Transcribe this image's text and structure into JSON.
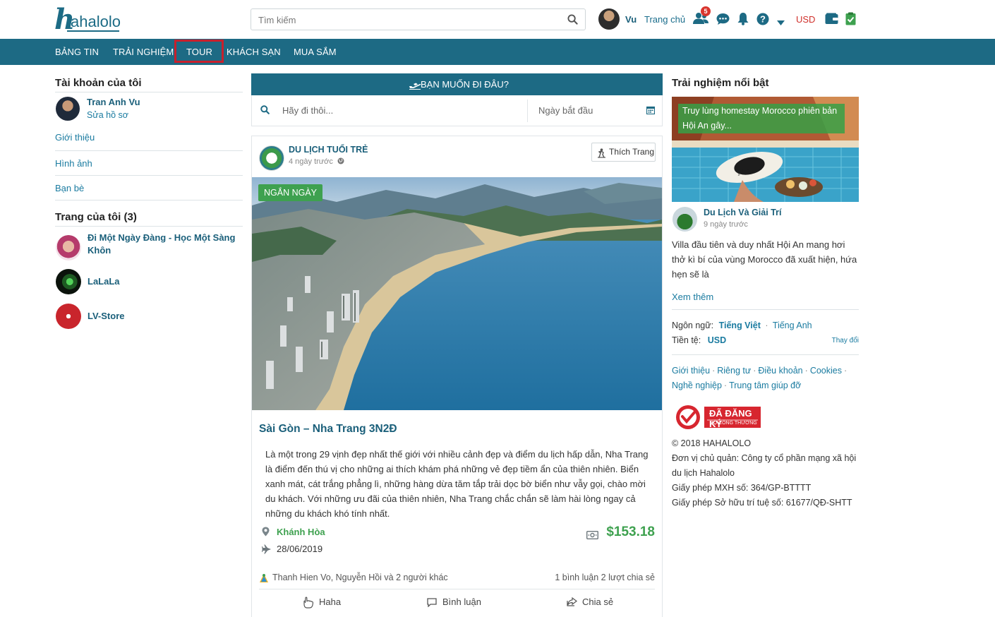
{
  "header": {
    "logo_h": "h",
    "logo_rest": "ahalolo",
    "search_placeholder": "Tìm kiếm",
    "user_name": "Vu",
    "home_label": "Trang chủ",
    "friend_badge": "5",
    "currency": "USD"
  },
  "nav": {
    "items": [
      "BẢNG TIN",
      "TRẢI NGHIỆM",
      "TOUR",
      "KHÁCH SẠN",
      "MUA SẮM"
    ],
    "active": "TOUR"
  },
  "left": {
    "account_title": "Tài khoản của tôi",
    "profile_name": "Tran Anh Vu",
    "profile_edit": "Sửa hồ sơ",
    "links": [
      "Giới thiệu",
      "Hình ảnh",
      "Bạn bè"
    ],
    "pages_title": "Trang của tôi (3)",
    "pages": [
      {
        "name_line1": "Đi Một Ngày Đàng - Học Một Sàng",
        "name_line2": "Khôn"
      },
      {
        "name_line1": "LaLaLa",
        "name_line2": ""
      },
      {
        "name_line1": "LV-Store",
        "name_line2": ""
      }
    ]
  },
  "center": {
    "dest_header": "BẠN MUỐN ĐI ĐÂU?",
    "dest_placeholder": "Hãy đi thôi...",
    "date_placeholder": "Ngày bắt đầu",
    "post": {
      "author": "DU LỊCH TUỔI TRẺ",
      "time": "4 ngày trước",
      "like_label": "Thích Trang",
      "tag": "NGẮN NGÀY",
      "title": "Sài Gòn – Nha Trang 3N2Đ",
      "description": "Là một trong 29 vịnh đẹp nhất thế giới với nhiều cảnh đẹp và điểm du lịch hấp dẫn, Nha Trang là điểm đến thú vị cho những ai thích khám phá những vẻ đẹp tiềm ẩn của thiên nhiên. Biển xanh mát, cát trắng phẳng lì, những hàng dừa tăm tắp trải dọc bờ biển như vẫy gọi, chào mời du khách. Với những ưu đãi của thiên nhiên, Nha Trang chắc chắn sẽ làm hài lòng ngay cả những du khách khó tính nhất.",
      "location": "Khánh Hòa",
      "date": "28/06/2019",
      "price": "$153.18",
      "reactions": "Thanh Hien Vo, Nguyễn Hồi và 2 người khác",
      "stats": "1 bình luận  2 lượt chia sẻ",
      "actions": [
        "Haha",
        "Bình luận",
        "Chia sẻ"
      ]
    }
  },
  "right": {
    "title": "Trải nghiệm nổi bật",
    "feature_caption": "Truy lùng homestay Morocco phiên bản Hội An gây...",
    "feature_author": "Du Lịch Và Giải Trí",
    "feature_time": "9 ngày trước",
    "feature_text": "Villa đầu tiên và duy nhất Hội An mang hơi thở kì bí của vùng Morocco đã xuất hiện, hứa hẹn sẽ là",
    "see_more": "Xem thêm",
    "lang_label": "Ngôn ngữ:",
    "lang_selected": "Tiếng Việt",
    "lang_alt": "Tiếng Anh",
    "currency_label": "Tiền tệ:",
    "currency_value": "USD",
    "change_label": "Thay đổi",
    "footer_links": [
      "Giới thiệu",
      "Riêng tư",
      "Điều khoản",
      "Cookies",
      "Nghề nghiệp",
      "Trung tâm giúp đỡ"
    ],
    "reg_line1": "ĐÃ ĐĂNG KÝ",
    "reg_line2": "BỘ CÔNG THƯƠNG",
    "copyright_lines": [
      "© 2018 HAHALOLO",
      "Đơn vị chủ quản: Công ty cổ phần mạng xã hội du lịch Hahalolo",
      "Giấy phép MXH số: 364/GP-BTTTT",
      "Giấy phép Sở hữu trí tuệ số: 61677/QĐ-SHTT"
    ]
  },
  "colors": {
    "brand": "#1d6a84",
    "accent_green": "#3ea14f",
    "currency_red": "#d0302b"
  }
}
